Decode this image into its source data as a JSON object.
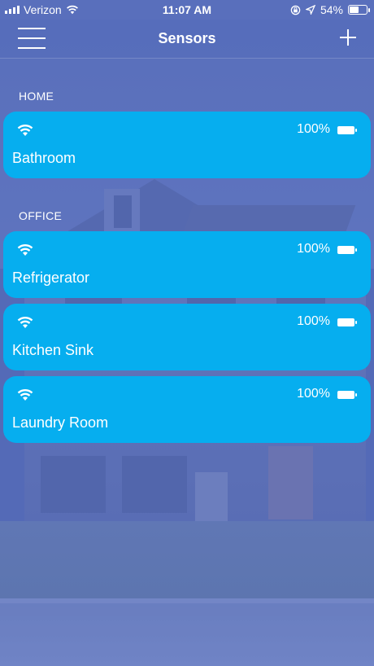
{
  "status_bar": {
    "carrier": "Verizon",
    "time": "11:07 AM",
    "battery": "54%",
    "battery_level": 0.54,
    "icons": [
      "signal-icon",
      "wifi-icon",
      "rotation-lock-icon",
      "location-arrow-icon",
      "battery-icon"
    ]
  },
  "nav": {
    "title": "Sensors",
    "menu_icon": "hamburger-menu-icon",
    "add_icon": "plus-icon"
  },
  "sections": [
    {
      "title": "HOME",
      "sensors": [
        {
          "name": "Bathroom",
          "battery": "100%"
        }
      ]
    },
    {
      "title": "OFFICE",
      "sensors": [
        {
          "name": "Refrigerator",
          "battery": "100%"
        },
        {
          "name": "Kitchen Sink",
          "battery": "100%"
        },
        {
          "name": "Laundry Room",
          "battery": "100%"
        }
      ]
    }
  ],
  "colors": {
    "card": "#06aeef",
    "background_overlay": "#5d70b8",
    "text": "#ffffff"
  }
}
